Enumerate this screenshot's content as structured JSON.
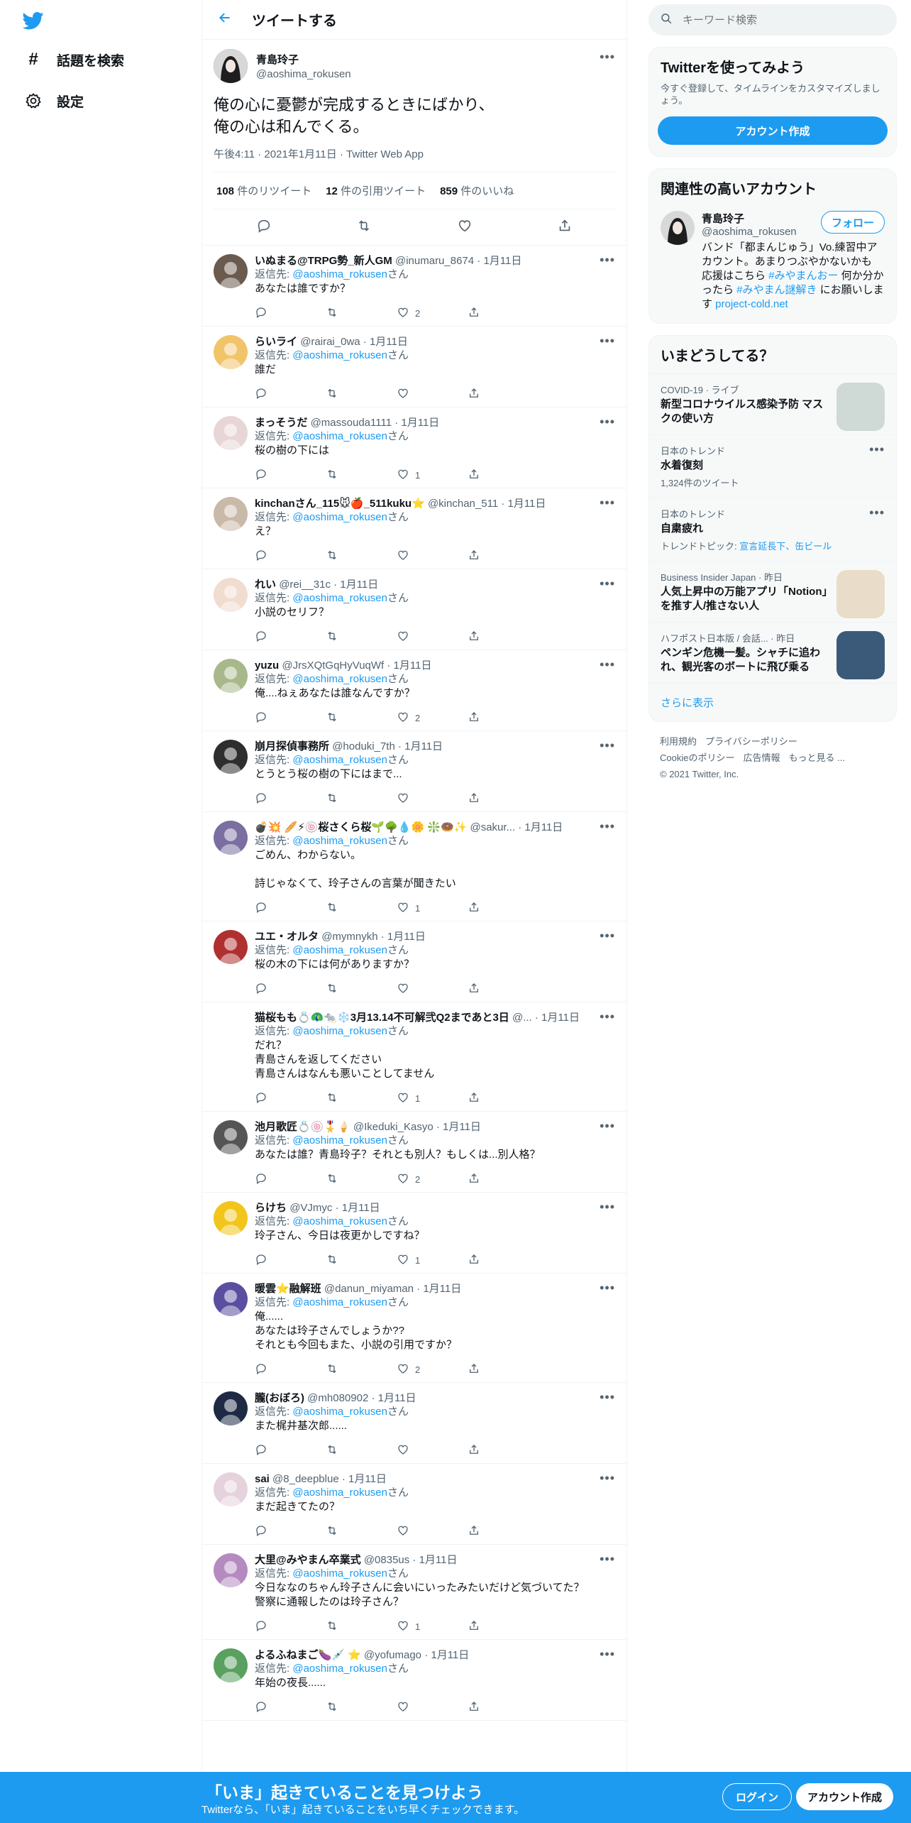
{
  "nav": {
    "items": [
      {
        "label": "話題を検索",
        "icon": "hashtag-icon"
      },
      {
        "label": "設定",
        "icon": "gear-icon"
      }
    ]
  },
  "header": {
    "title": "ツイートする"
  },
  "main_tweet": {
    "name": "青島玲子",
    "handle": "@aoshima_rokusen",
    "text": "俺の心に憂鬱が完成するときにばかり、\n俺の心は和んでくる。",
    "meta": "午後4:11 · 2021年1月11日 · Twitter Web App",
    "retweets": "108",
    "retweets_label": "件のリツイート",
    "quotes": "12",
    "quotes_label": "件の引用ツイート",
    "likes": "859",
    "likes_label": "件のいいね"
  },
  "reply_prefix": "返信先: ",
  "reply_suffix": "さん",
  "reply_to_handle": "@aoshima_rokusen",
  "replies": [
    {
      "name": "いぬまる@TRPG勢_新人GM",
      "meta": "@inumaru_8674 · 1月11日",
      "text": "あなたは誰ですか？",
      "likes": "2",
      "avatar_color": "#6b5a4e"
    },
    {
      "name": "らいライ",
      "meta": "@rairai_0wa · 1月11日",
      "text": "誰だ",
      "likes": "",
      "avatar_color": "#f2c46a"
    },
    {
      "name": "まっそうだ",
      "meta": "@massouda1111 · 1月11日",
      "text": "桜の樹の下には",
      "likes": "1",
      "avatar_color": "#e8d6d6"
    },
    {
      "name": "kinchanさん_115🐭🍎_511kuku⭐",
      "meta": "@kinchan_511 · 1月11日",
      "text": "え？",
      "likes": "",
      "avatar_color": "#c9b9a8"
    },
    {
      "name": "れい",
      "meta": "@rei__31c · 1月11日",
      "text": "小説のセリフ？",
      "likes": "",
      "avatar_color": "#f1dcd0"
    },
    {
      "name": "yuzu",
      "meta": "@JrsXQtGqHyVuqWf · 1月11日",
      "text": "俺....ねぇあなたは誰なんですか？",
      "likes": "2",
      "avatar_color": "#a8b88a"
    },
    {
      "name": "崩月探偵事務所",
      "meta": "@hoduki_7th · 1月11日",
      "text": "とうとう桜の樹の下にはまで...",
      "likes": "",
      "avatar_color": "#2e2e2e"
    },
    {
      "name": "💣💥 🥖⚡🍥桜さくら桜🌱🌳💧🌼 ❇️🍩✨",
      "meta": "@sakur... · 1月11日",
      "text": "ごめん、わからない。\n\n詩じゃなくて、玲子さんの言葉が聞きたい",
      "likes": "1",
      "avatar_color": "#7a6fa0"
    },
    {
      "name": "ユエ・オルタ",
      "meta": "@mymnykh · 1月11日",
      "text": "桜の木の下には何がありますか？",
      "likes": "",
      "avatar_color": "#b03030"
    },
    {
      "name": "猫桜もも💍🦚🐀❄️3月13.14不可解弐Q2まであと3日",
      "meta": "@... · 1月11日",
      "text": "だれ？\n青島さんを返してください\n青島さんはなんも悪いことしてません",
      "likes": "1",
      "avatar_color": "#ffffff"
    },
    {
      "name": "池月歌匠💍🍥🎖️🍦",
      "meta": "@Ikeduki_Kasyo · 1月11日",
      "text": "あなたは誰？青島玲子？それとも別人？もしくは...別人格？",
      "likes": "2",
      "avatar_color": "#555555"
    },
    {
      "name": "らけち",
      "meta": "@VJmyc · 1月11日",
      "text": "玲子さん、今日は夜更かしですね？",
      "likes": "1",
      "avatar_color": "#f2c51a"
    },
    {
      "name": "暖雲⭐融解班",
      "meta": "@danun_miyaman · 1月11日",
      "text": "俺......\nあなたは玲子さんでしょうか??\nそれとも今回もまた、小説の引用ですか？",
      "likes": "2",
      "avatar_color": "#5a4ea0"
    },
    {
      "name": "朧(おぼろ)",
      "meta": "@mh080902 · 1月11日",
      "text": "また梶井基次郎......",
      "likes": "",
      "avatar_color": "#1e2a44"
    },
    {
      "name": "sai",
      "meta": "@8_deepblue · 1月11日",
      "text": "まだ起きてたの？",
      "likes": "",
      "avatar_color": "#e6d2dc"
    },
    {
      "name": "大里@みやまん卒業式",
      "meta": "@0835us · 1月11日",
      "text": "今日ななのちゃん玲子さんに会いにいったみたいだけど気づいてた？\n警察に通報したのは玲子さん？",
      "likes": "1",
      "avatar_color": "#b48ac0"
    },
    {
      "name": "よるふねまご🍆💉 ⭐",
      "meta": "@yofumago · 1月11日",
      "text": "年始の夜長......",
      "likes": "",
      "avatar_color": "#5aa060"
    }
  ],
  "search": {
    "placeholder": "キーワード検索"
  },
  "join": {
    "title": "Twitterを使ってみよう",
    "desc": "今すぐ登録して、タイムラインをカスタマイズしましょう。",
    "button": "アカウント作成"
  },
  "related": {
    "title": "関連性の高いアカウント",
    "name": "青島玲子",
    "handle": "@aoshima_rokusen",
    "follow": "フォロー",
    "bio_1": "バンド「都まんじゅう」Vo.練習中アカウント。あまりつぶやかないかも 応援はこちら ",
    "bio_tag1": "#みやまんおー",
    "bio_2": " 何か分かったら ",
    "bio_tag2": "#みやまん謎解き",
    "bio_3": " にお願いします ",
    "bio_link": "project-cold.net"
  },
  "trends": {
    "title": "いまどうしてる？",
    "items": [
      {
        "cat": "COVID-19 · ライブ",
        "title": "新型コロナウイルス感染予防 マスクの使い方",
        "sub": "",
        "sub_link": ""
      },
      {
        "cat": "日本のトレンド",
        "title": "水着復刻",
        "sub": "1,324件のツイート",
        "sub_link": ""
      },
      {
        "cat": "日本のトレンド",
        "title": "自粛疲れ",
        "sub": "トレンドトピック: ",
        "sub_link": "宣言延長下、缶ビール"
      },
      {
        "cat": "Business Insider Japan · 昨日",
        "title": "人気上昇中の万能アプリ「Notion」を推す人/推さない人",
        "sub": "",
        "sub_link": ""
      },
      {
        "cat": "ハフポスト日本版 / 会話... · 昨日",
        "title": "ペンギン危機一髪。シャチに追われ、観光客のボートに飛び乗る",
        "sub": "",
        "sub_link": ""
      }
    ],
    "more": "さらに表示"
  },
  "footer": {
    "line1": [
      "利用規約",
      "プライバシーポリシー"
    ],
    "line2": [
      "Cookieのポリシー",
      "広告情報",
      "もっと見る ..."
    ],
    "copyright": "© 2021 Twitter, Inc."
  },
  "bottombar": {
    "title": "「いま」起きていることを見つけよう",
    "sub": "Twitterなら、「いま」起きていることをいち早くチェックできます。",
    "login": "ログイン",
    "signup": "アカウント作成"
  },
  "colors": {
    "accent": "#1d9bf0",
    "text": "#0f1419",
    "muted": "#536471",
    "border": "#eff3f4"
  }
}
